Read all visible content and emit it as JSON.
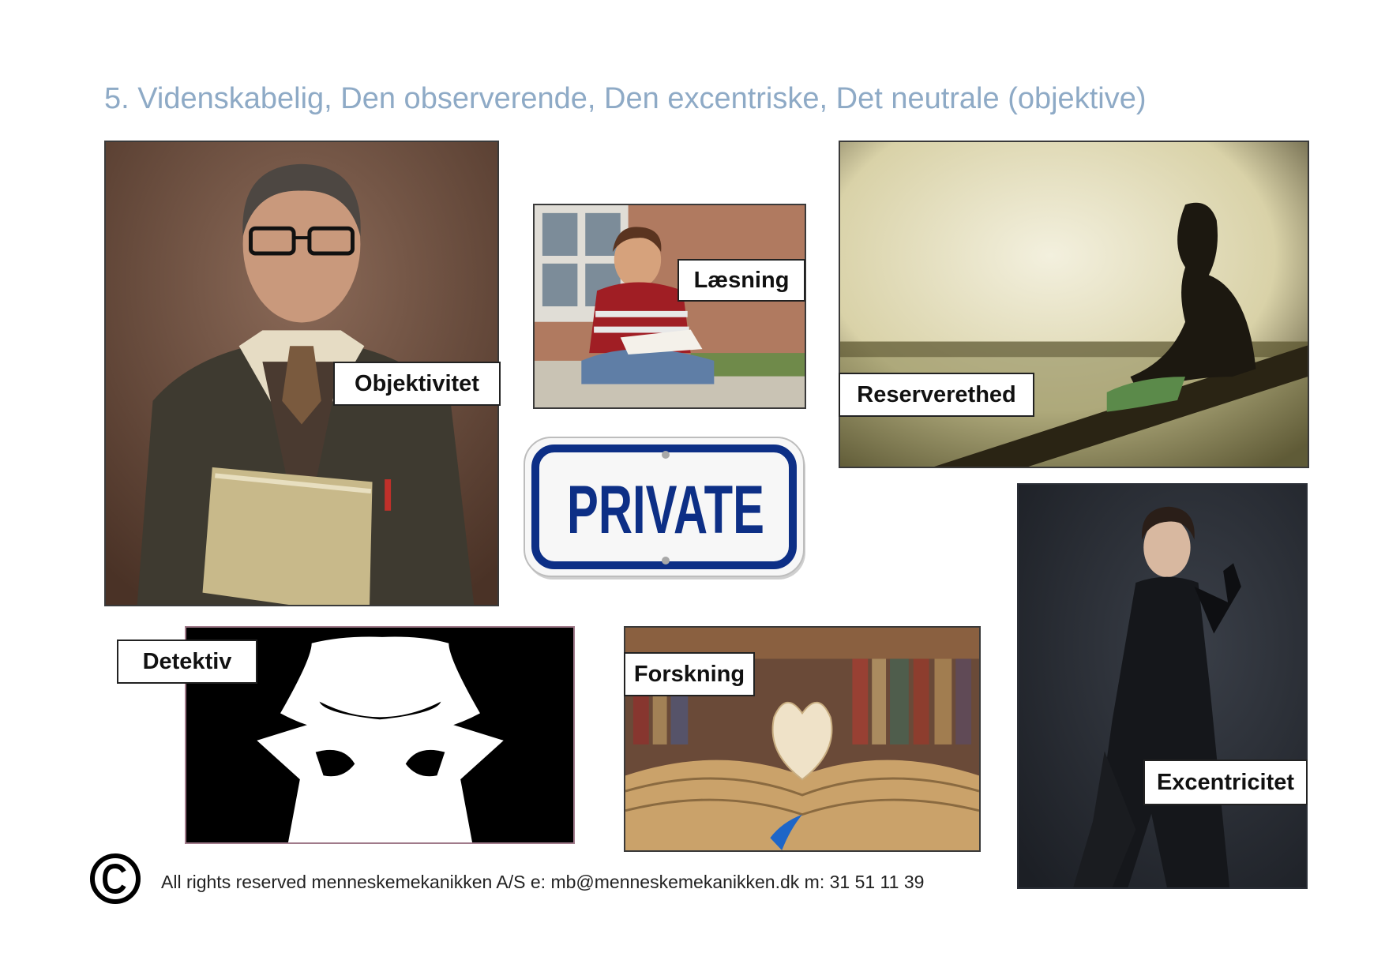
{
  "page": {
    "title": "5. Videnskabelig, Den observerende, Den excentriske, Det neutrale (objektive)"
  },
  "labels": {
    "objektivitet": "Objektivitet",
    "laesning": "Læsning",
    "reserverethed": "Reserverethed",
    "detektiv": "Detektiv",
    "forskning": "Forskning",
    "excentricitet": "Excentricitet"
  },
  "sign": {
    "text": "PRIVATE",
    "color": "#0d2f86"
  },
  "footer": {
    "text": "All rights reserved menneskemekanikken A/S e: mb@menneskemekanikken.dk m: 31 51 11 39",
    "icon": "copyright-icon"
  },
  "colors": {
    "title": "#8eaac6",
    "label_border": "#222222"
  }
}
